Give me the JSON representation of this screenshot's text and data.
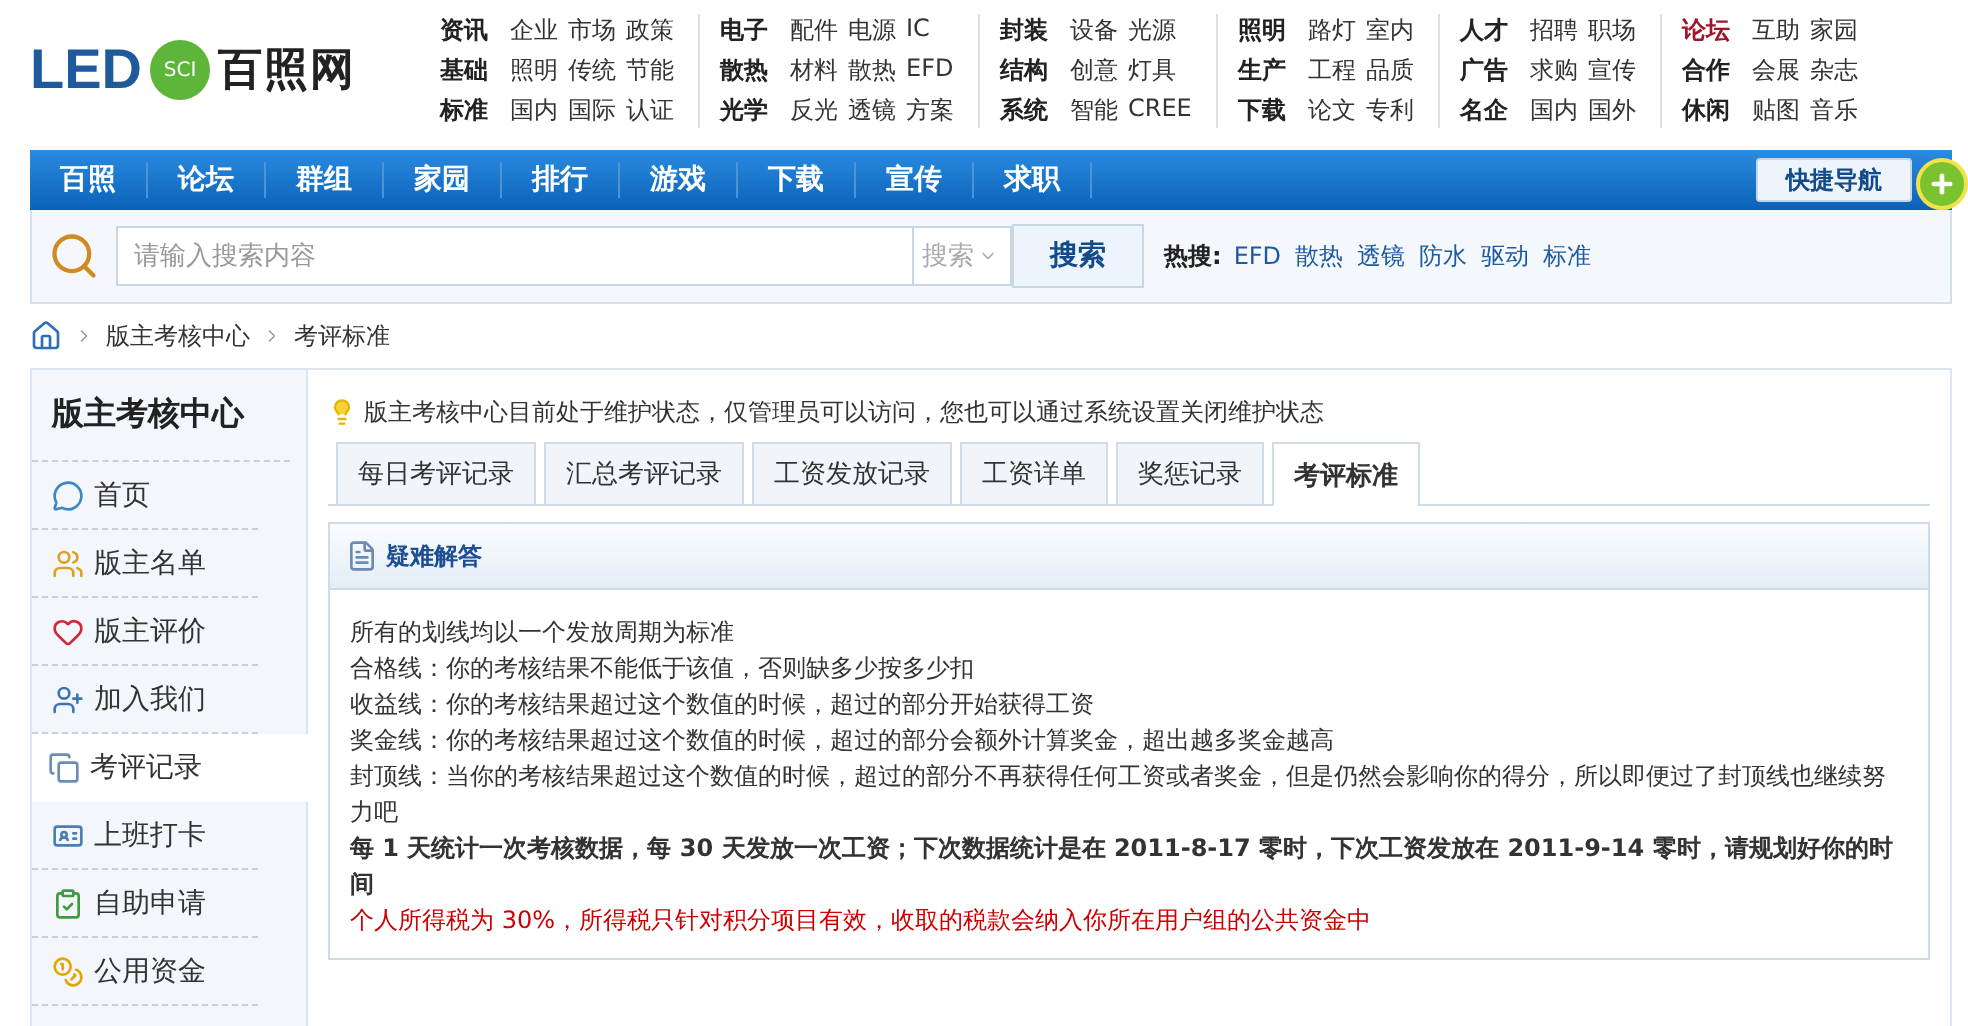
{
  "logo": {
    "text": "LED",
    "badge": "SCI",
    "name": "百照网"
  },
  "link_groups": [
    {
      "rows": [
        {
          "category": "资讯",
          "highlight": false,
          "links": [
            "企业",
            "市场",
            "政策"
          ]
        },
        {
          "category": "基础",
          "highlight": false,
          "links": [
            "照明",
            "传统",
            "节能"
          ]
        },
        {
          "category": "标准",
          "highlight": false,
          "links": [
            "国内",
            "国际",
            "认证"
          ]
        }
      ]
    },
    {
      "rows": [
        {
          "category": "电子",
          "highlight": false,
          "links": [
            "配件",
            "电源",
            "IC"
          ]
        },
        {
          "category": "散热",
          "highlight": false,
          "links": [
            "材料",
            "散热",
            "EFD"
          ]
        },
        {
          "category": "光学",
          "highlight": false,
          "links": [
            "反光",
            "透镜",
            "方案"
          ]
        }
      ]
    },
    {
      "rows": [
        {
          "category": "封装",
          "highlight": false,
          "links": [
            "设备",
            "光源"
          ]
        },
        {
          "category": "结构",
          "highlight": false,
          "links": [
            "创意",
            "灯具"
          ]
        },
        {
          "category": "系统",
          "highlight": false,
          "links": [
            "智能",
            "CREE"
          ]
        }
      ]
    },
    {
      "rows": [
        {
          "category": "照明",
          "highlight": false,
          "links": [
            "路灯",
            "室内"
          ]
        },
        {
          "category": "生产",
          "highlight": false,
          "links": [
            "工程",
            "品质"
          ]
        },
        {
          "category": "下载",
          "highlight": false,
          "links": [
            "论文",
            "专利"
          ]
        }
      ]
    },
    {
      "rows": [
        {
          "category": "人才",
          "highlight": false,
          "links": [
            "招聘",
            "职场"
          ]
        },
        {
          "category": "广告",
          "highlight": false,
          "links": [
            "求购",
            "宣传"
          ]
        },
        {
          "category": "名企",
          "highlight": false,
          "links": [
            "国内",
            "国外"
          ]
        }
      ]
    },
    {
      "rows": [
        {
          "category": "论坛",
          "highlight": true,
          "links": [
            "互助",
            "家园"
          ]
        },
        {
          "category": "合作",
          "highlight": false,
          "links": [
            "会展",
            "杂志"
          ]
        },
        {
          "category": "休闲",
          "highlight": false,
          "links": [
            "贴图",
            "音乐"
          ]
        }
      ]
    }
  ],
  "nav": {
    "items": [
      "百照",
      "论坛",
      "群组",
      "家园",
      "排行",
      "游戏",
      "下载",
      "宣传",
      "求职"
    ],
    "quick_nav": "快捷导航"
  },
  "search": {
    "placeholder": "请输入搜索内容",
    "scope": "搜索",
    "button": "搜索",
    "hot_label": "热搜:",
    "hot": [
      "EFD",
      "散热",
      "透镜",
      "防水",
      "驱动",
      "标准"
    ]
  },
  "breadcrumb": [
    "版主考核中心",
    "考评标准"
  ],
  "sidebar": {
    "title": "版主考核中心",
    "items": [
      {
        "label": "首页",
        "selected": false
      },
      {
        "label": "版主名单",
        "selected": false
      },
      {
        "label": "版主评价",
        "selected": false
      },
      {
        "label": "加入我们",
        "selected": false
      },
      {
        "label": "考评记录",
        "selected": true
      },
      {
        "label": "上班打卡",
        "selected": false
      },
      {
        "label": "自助申请",
        "selected": false
      },
      {
        "label": "公用资金",
        "selected": false
      }
    ]
  },
  "notice": "版主考核中心目前处于维护状态，仅管理员可以访问，您也可以通过系统设置关闭维护状态",
  "tabs": [
    {
      "label": "每日考评记录",
      "selected": false
    },
    {
      "label": "汇总考评记录",
      "selected": false
    },
    {
      "label": "工资发放记录",
      "selected": false
    },
    {
      "label": "工资详单",
      "selected": false
    },
    {
      "label": "奖惩记录",
      "selected": false
    },
    {
      "label": "考评标准",
      "selected": true
    }
  ],
  "panel": {
    "title": "疑难解答",
    "lines": [
      {
        "kind": "plain",
        "text": "所有的划线均以一个发放周期为标准"
      },
      {
        "kind": "plain",
        "text": "合格线：你的考核结果不能低于该值，否则缺多少按多少扣"
      },
      {
        "kind": "plain",
        "text": "收益线：你的考核结果超过这个数值的时候，超过的部分开始获得工资"
      },
      {
        "kind": "plain",
        "text": "奖金线：你的考核结果超过这个数值的时候，超过的部分会额外计算奖金，超出越多奖金越高"
      },
      {
        "kind": "plain",
        "text": "封顶线：当你的考核结果超过这个数值的时候，超过的部分不再获得任何工资或者奖金，但是仍然会影响你的得分，所以即便过了封顶线也继续努力吧"
      },
      {
        "kind": "bold",
        "text": "每 1 天统计一次考核数据，每 30 天发放一次工资；下次数据统计是在 2011-8-17 零时，下次工资发放在 2011-9-14 零时，请规划好你的时间"
      },
      {
        "kind": "warning",
        "text": "个人所得税为 30%，所得税只针对积分项目有效，收取的税款会纳入你所在用户组的公共资金中"
      }
    ]
  }
}
